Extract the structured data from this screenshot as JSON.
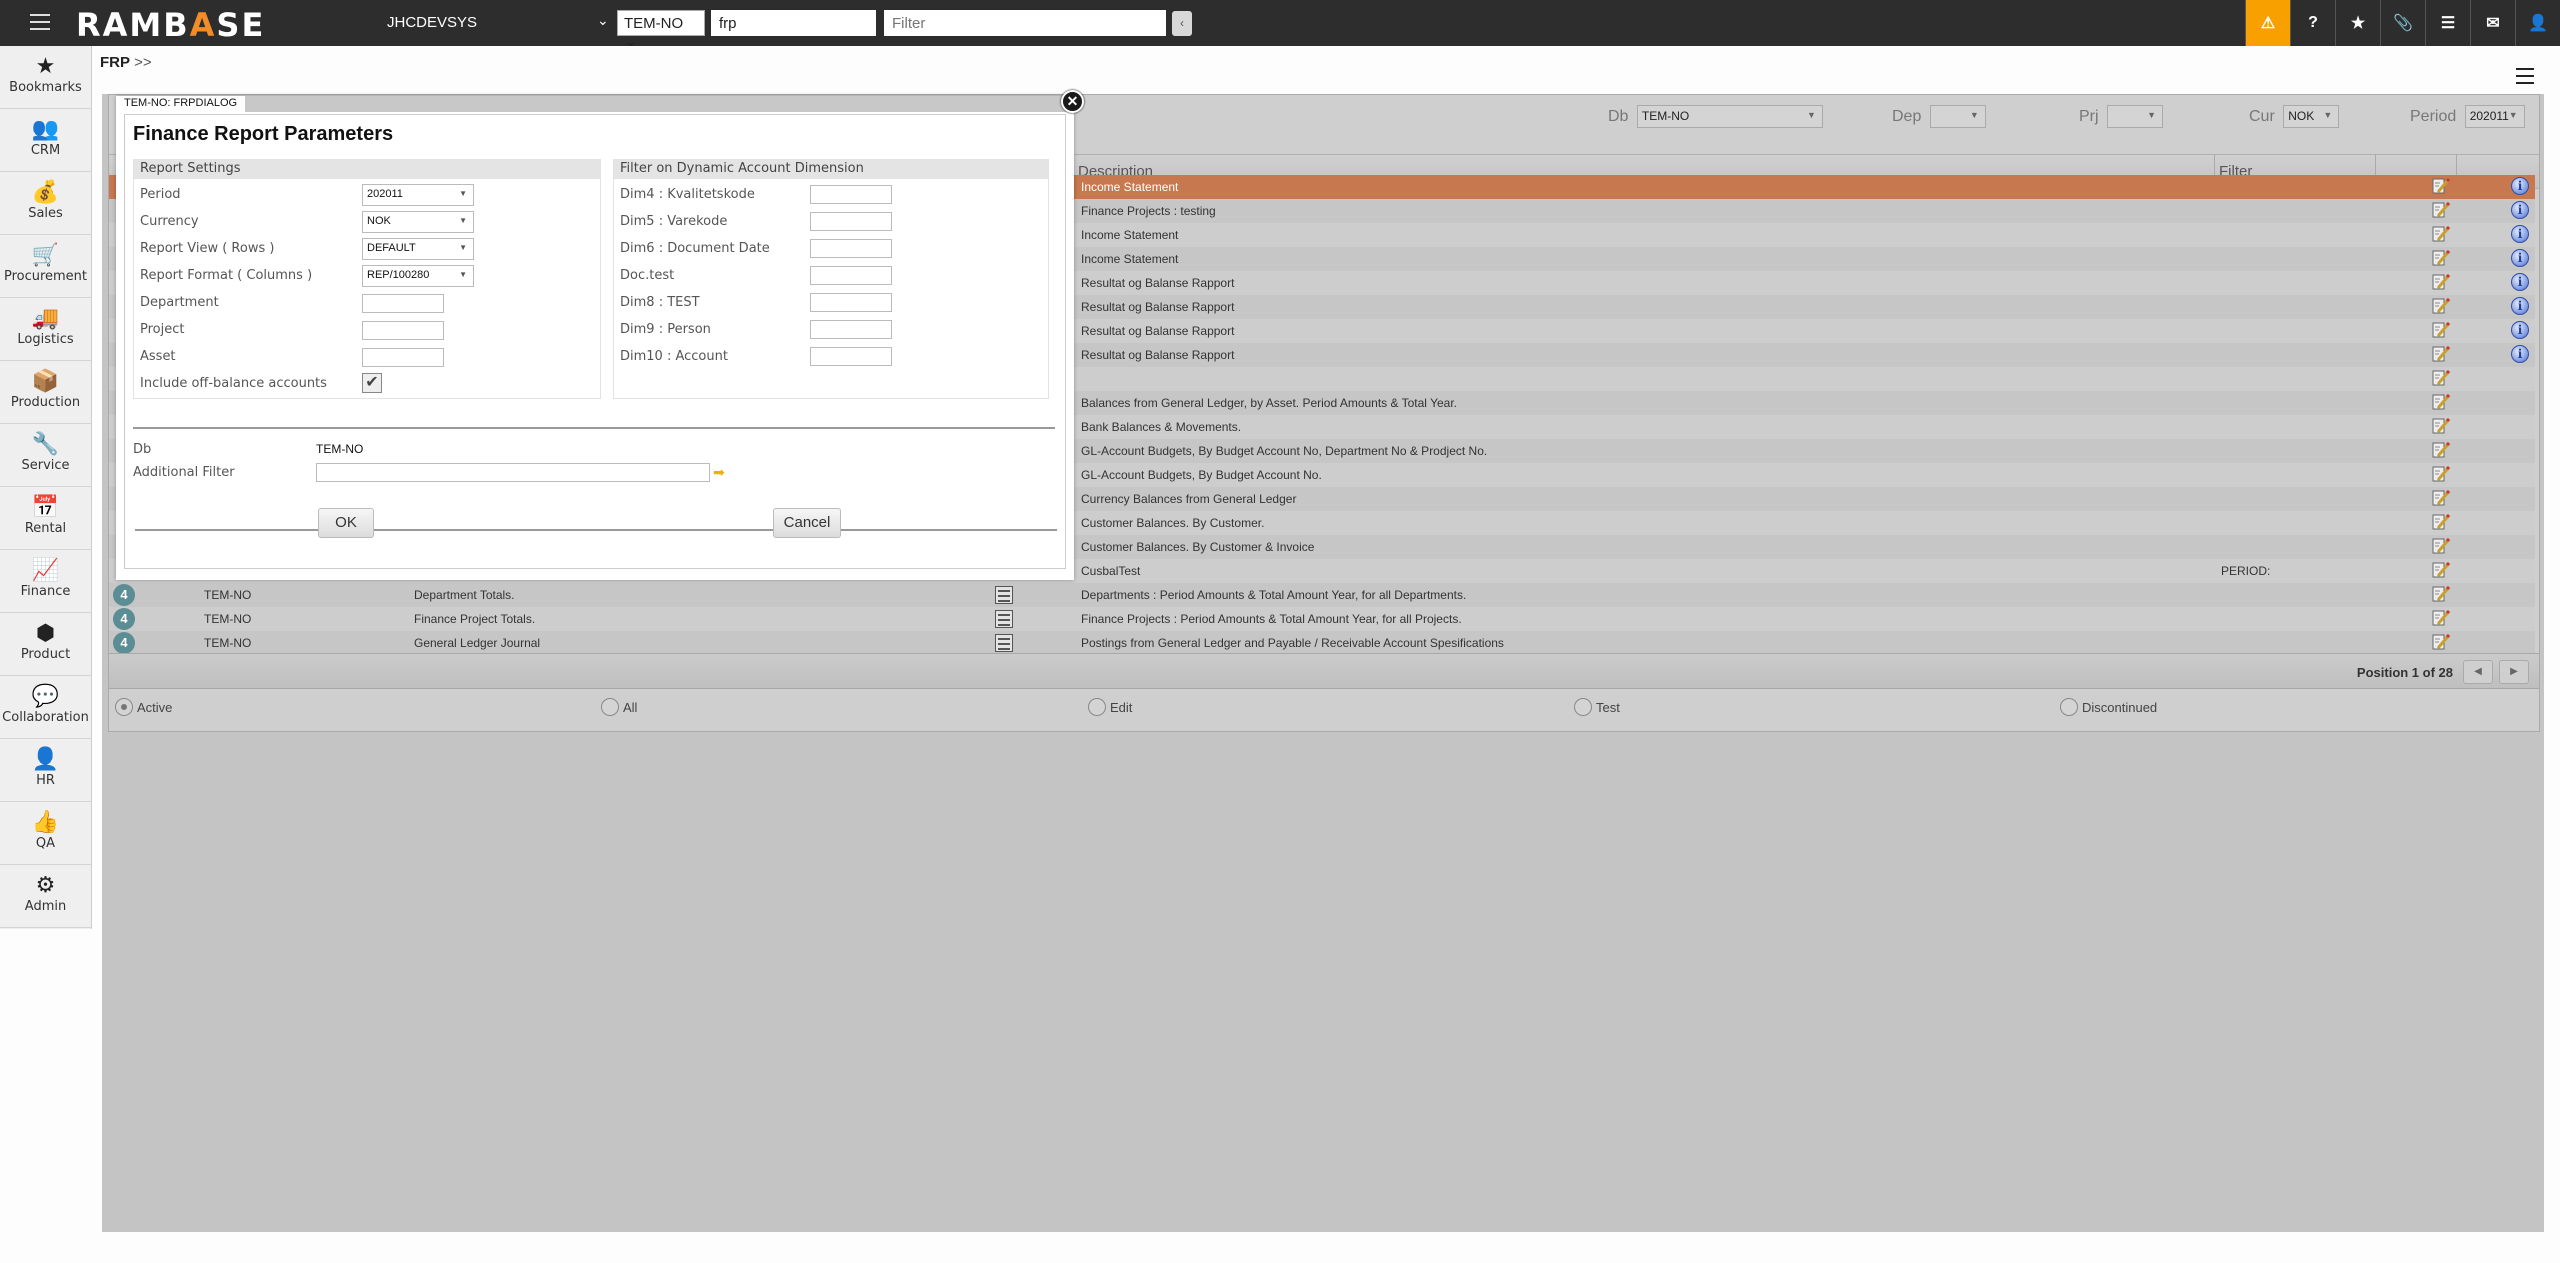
{
  "topbar": {
    "logo": "RAMBASE",
    "system_name": "JHCDEVSYS",
    "db_selected": "TEM-NO",
    "search_value": "frp",
    "filter_placeholder": "Filter",
    "collapse_glyph": "‹",
    "icons": [
      {
        "name": "warning-icon",
        "glyph": "⚠"
      },
      {
        "name": "help-icon",
        "glyph": "?"
      },
      {
        "name": "star-icon",
        "glyph": "★"
      },
      {
        "name": "paperclip-icon",
        "glyph": "📎"
      },
      {
        "name": "list-icon",
        "glyph": "☰"
      },
      {
        "name": "mail-icon",
        "glyph": "✉"
      },
      {
        "name": "user-icon",
        "glyph": "👤"
      }
    ],
    "accent_color": "#f7a000"
  },
  "sidebar": {
    "items": [
      {
        "label": "Bookmarks",
        "icon": "star-icon",
        "glyph": "★"
      },
      {
        "label": "CRM",
        "icon": "people-icon",
        "glyph": "👥"
      },
      {
        "label": "Sales",
        "icon": "money-bag-icon",
        "glyph": "💰"
      },
      {
        "label": "Procurement",
        "icon": "cart-icon",
        "glyph": "🛒"
      },
      {
        "label": "Logistics",
        "icon": "truck-icon",
        "glyph": "🚚"
      },
      {
        "label": "Production",
        "icon": "boxes-icon",
        "glyph": "📦"
      },
      {
        "label": "Service",
        "icon": "wrench-icon",
        "glyph": "🔧"
      },
      {
        "label": "Rental",
        "icon": "rental-calendar-icon",
        "glyph": "📅"
      },
      {
        "label": "Finance",
        "icon": "chart-line-icon",
        "glyph": "📈"
      },
      {
        "label": "Product",
        "icon": "cube-icon",
        "glyph": "⬢"
      },
      {
        "label": "Collaboration",
        "icon": "chat-icon",
        "glyph": "💬"
      },
      {
        "label": "HR",
        "icon": "person-icon",
        "glyph": "👤"
      },
      {
        "label": "QA",
        "icon": "thumbs-up-icon",
        "glyph": "👍"
      },
      {
        "label": "Admin",
        "icon": "gear-icon",
        "glyph": "⚙"
      }
    ]
  },
  "breadcrumb": {
    "current": "FRP",
    "sep": ">>"
  },
  "panel": {
    "toolbar": {
      "db_label": "Db",
      "db_value": "TEM-NO",
      "dep_label": "Dep",
      "dep_value": "",
      "prj_label": "Prj",
      "prj_value": "",
      "cur_label": "Cur",
      "cur_value": "NOK",
      "period_label": "Period",
      "period_value": "202011"
    },
    "headers": {
      "description": "Description",
      "filter": "Filter"
    },
    "rows": [
      {
        "status": "",
        "db": "",
        "name": "",
        "description": "Income Statement",
        "filter": "",
        "info": true,
        "selected": true
      },
      {
        "status": "",
        "db": "",
        "name": "",
        "description": "Finance Projects : testing",
        "filter": "",
        "info": true
      },
      {
        "status": "",
        "db": "",
        "name": "",
        "description": "Income Statement",
        "filter": "",
        "info": true
      },
      {
        "status": "",
        "db": "",
        "name": "",
        "description": "Income Statement",
        "filter": "",
        "info": true
      },
      {
        "status": "",
        "db": "",
        "name": "",
        "description": "Resultat og Balanse Rapport",
        "filter": "",
        "info": true
      },
      {
        "status": "",
        "db": "",
        "name": "",
        "description": "Resultat og Balanse Rapport",
        "filter": "",
        "info": true
      },
      {
        "status": "",
        "db": "",
        "name": "",
        "description": "Resultat og Balanse Rapport",
        "filter": "",
        "info": true
      },
      {
        "status": "",
        "db": "",
        "name": "",
        "description": "Resultat og Balanse Rapport",
        "filter": "",
        "info": true
      },
      {
        "status": "",
        "db": "",
        "name": "",
        "description": "",
        "filter": "",
        "info": false
      },
      {
        "status": "",
        "db": "",
        "name": "",
        "description": "Balances from General Ledger, by Asset. Period Amounts & Total Year.",
        "filter": "",
        "info": false
      },
      {
        "status": "",
        "db": "",
        "name": "",
        "description": "Bank Balances & Movements.",
        "filter": "",
        "info": false
      },
      {
        "status": "",
        "db": "",
        "name": "",
        "description": "GL-Account Budgets, By Budget Account No, Department No & Prodject No.",
        "filter": "",
        "info": false
      },
      {
        "status": "",
        "db": "",
        "name": "",
        "description": "GL-Account Budgets, By Budget Account No.",
        "filter": "",
        "info": false
      },
      {
        "status": "",
        "db": "",
        "name": "",
        "description": "Currency Balances from General Ledger",
        "filter": "",
        "info": false
      },
      {
        "status": "",
        "db": "",
        "name": "",
        "description": "Customer Balances. By Customer.",
        "filter": "",
        "info": false
      },
      {
        "status": "",
        "db": "",
        "name": "",
        "description": "Customer Balances. By Customer & Invoice",
        "filter": "",
        "info": false
      },
      {
        "status": "",
        "db": "",
        "name": "",
        "description": "CusbalTest",
        "filter": "PERIOD:",
        "info": false
      },
      {
        "status": "4",
        "db": "TEM-NO",
        "name": "Department Totals.",
        "description": "Departments : Period Amounts & Total Amount Year, for all Departments.",
        "filter": "",
        "info": false
      },
      {
        "status": "4",
        "db": "TEM-NO",
        "name": "Finance Project Totals.",
        "description": "Finance Projects : Period Amounts & Total Amount Year, for all Projects.",
        "filter": "",
        "info": false
      },
      {
        "status": "4",
        "db": "TEM-NO",
        "name": "General Ledger Journal",
        "description": "Postings from General Ledger and Payable / Receivable Account Spesifications",
        "filter": "",
        "info": false
      }
    ],
    "selected_row_color": "#c8784e",
    "position_text": "Position 1 of 28",
    "prev_glyph": "◀",
    "next_glyph": "▶",
    "radios": [
      {
        "label": "Active",
        "checked": true
      },
      {
        "label": "All",
        "checked": false
      },
      {
        "label": "Edit",
        "checked": false
      },
      {
        "label": "Test",
        "checked": false
      },
      {
        "label": "Discontinued",
        "checked": false
      }
    ]
  },
  "dialog": {
    "tab_label": "TEM-NO: FRPDIALOG",
    "title": "Finance Report Parameters",
    "close_glyph": "✕",
    "report_settings": {
      "heading": "Report Settings",
      "period_label": "Period",
      "period_value": "202011",
      "currency_label": "Currency",
      "currency_value": "NOK",
      "view_label": "Report View ( Rows )",
      "view_value": "DEFAULT",
      "format_label": "Report Format ( Columns )",
      "format_value": "REP/100280",
      "department_label": "Department",
      "department_value": "",
      "project_label": "Project",
      "project_value": "",
      "asset_label": "Asset",
      "asset_value": "",
      "offbalance_label": "Include off-balance accounts",
      "offbalance_checked": true,
      "check_glyph": "✔"
    },
    "dimension_filter": {
      "heading": "Filter on Dynamic Account Dimension",
      "fields": [
        {
          "label": "Dim4 : Kvalitetskode",
          "value": ""
        },
        {
          "label": "Dim5 : Varekode",
          "value": ""
        },
        {
          "label": "Dim6 : Document Date",
          "value": ""
        },
        {
          "label": "Doc.test",
          "value": ""
        },
        {
          "label": "Dim8 : TEST",
          "value": ""
        },
        {
          "label": "Dim9 : Person",
          "value": ""
        },
        {
          "label": "Dim10 : Account",
          "value": ""
        }
      ]
    },
    "db_label": "Db",
    "db_value": "TEM-NO",
    "additional_filter_label": "Additional Filter",
    "additional_filter_value": "",
    "go_glyph": "➡",
    "ok_label": "OK",
    "cancel_label": "Cancel"
  }
}
